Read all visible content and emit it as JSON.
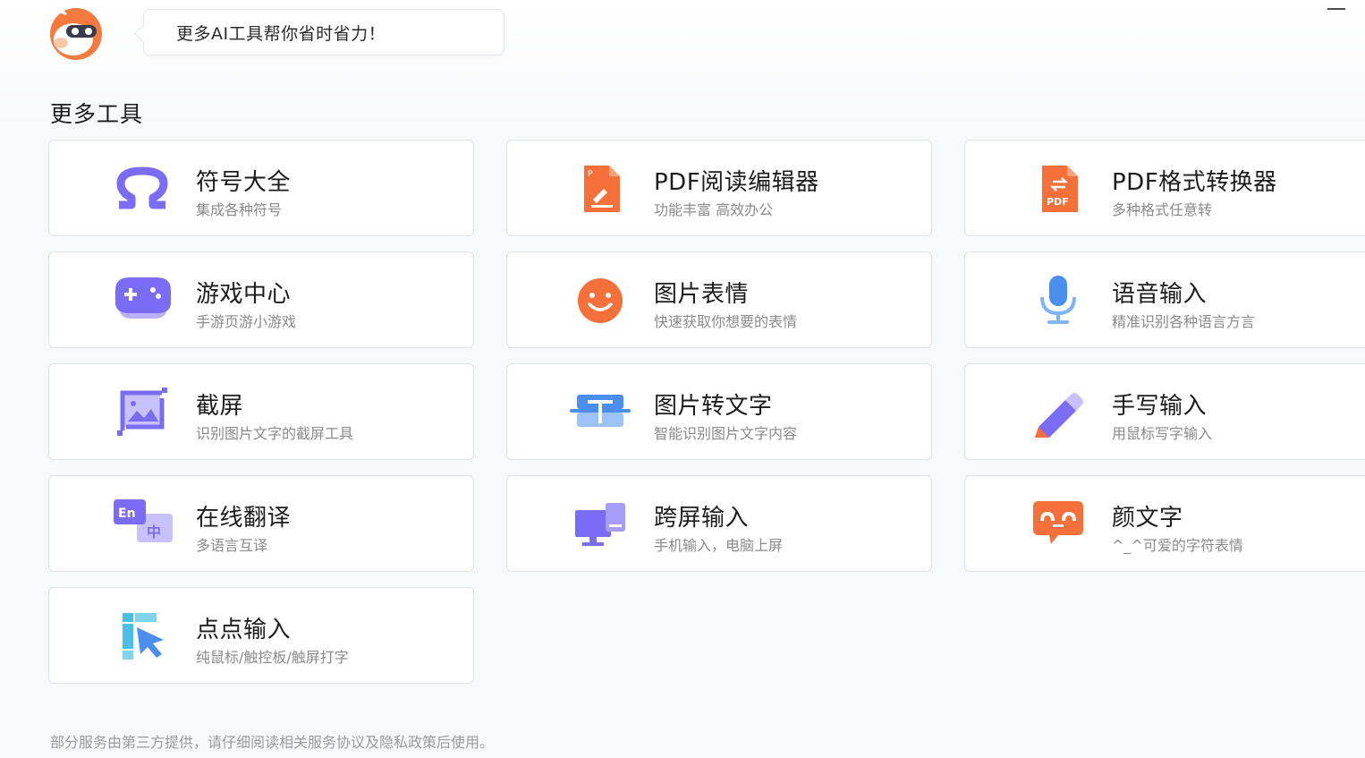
{
  "header": {
    "bubble_text": "更多AI工具帮你省时省力！"
  },
  "section": {
    "title": "更多工具"
  },
  "tools": [
    {
      "title": "符号大全",
      "desc": "集成各种符号",
      "icon": "omega-icon"
    },
    {
      "title": "PDF阅读编辑器",
      "desc": "功能丰富 高效办公",
      "icon": "pdf-edit-icon"
    },
    {
      "title": "PDF格式转换器",
      "desc": "多种格式任意转",
      "icon": "pdf-convert-icon"
    },
    {
      "title": "游戏中心",
      "desc": "手游页游小游戏",
      "icon": "gamepad-icon"
    },
    {
      "title": "图片表情",
      "desc": "快速获取你想要的表情",
      "icon": "smiley-icon"
    },
    {
      "title": "语音输入",
      "desc": "精准识别各种语言方言",
      "icon": "microphone-icon"
    },
    {
      "title": "截屏",
      "desc": "识别图片文字的截屏工具",
      "icon": "screenshot-icon"
    },
    {
      "title": "图片转文字",
      "desc": "智能识别图片文字内容",
      "icon": "image-to-text-icon"
    },
    {
      "title": "手写输入",
      "desc": "用鼠标写字输入",
      "icon": "pen-icon"
    },
    {
      "title": "在线翻译",
      "desc": "多语言互译",
      "icon": "translate-icon",
      "badge_en": "En",
      "badge_zh": "中"
    },
    {
      "title": "跨屏输入",
      "desc": "手机输入，电脑上屏",
      "icon": "cross-screen-icon"
    },
    {
      "title": "颜文字",
      "desc": "^_^可爱的字符表情",
      "icon": "kaomoji-icon"
    },
    {
      "title": "点点输入",
      "desc": "纯鼠标/触控板/触屏打字",
      "icon": "cursor-click-icon"
    }
  ],
  "footer": {
    "text": "部分服务由第三方提供，请仔细阅读相关服务协议及隐私政策后使用。"
  },
  "colors": {
    "purple": "#7b6cf6",
    "orange": "#f5703a",
    "blue": "#4a8ff0"
  }
}
